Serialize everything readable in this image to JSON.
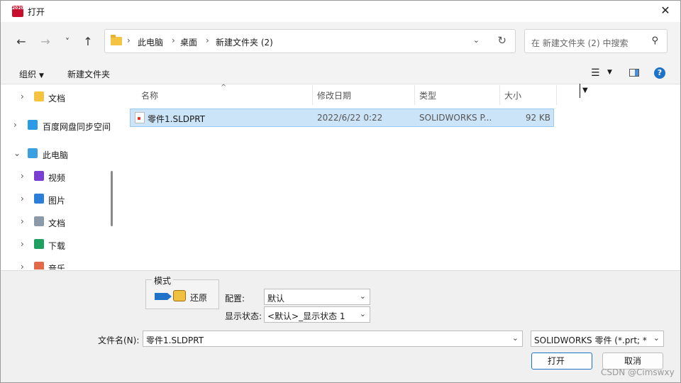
{
  "window": {
    "title": "打开",
    "app_icon_text": "2020"
  },
  "nav": {
    "back": "←",
    "forward": "→",
    "recent": "˅",
    "up": "↑"
  },
  "address": {
    "crumbs": [
      "此电脑",
      "桌面",
      "新建文件夹 (2)"
    ],
    "separator": "›"
  },
  "search": {
    "placeholder": "在 新建文件夹 (2) 中搜索"
  },
  "toolbar": {
    "organize": "组织",
    "new_folder": "新建文件夹"
  },
  "sidebar": {
    "items": [
      {
        "label": "文档",
        "icon": "document-icon",
        "color": "#f5c342",
        "indent": 1
      },
      {
        "label": "百度网盘同步空间",
        "icon": "baidu-netdisk-icon",
        "color": "#2b9be6",
        "indent": 0
      },
      {
        "label": "此电脑",
        "icon": "computer-icon",
        "color": "#3aa0e0",
        "indent": 0,
        "expanded": true
      },
      {
        "label": "视频",
        "icon": "video-icon",
        "color": "#7a3fd0",
        "indent": 1
      },
      {
        "label": "图片",
        "icon": "picture-icon",
        "color": "#2b7fd6",
        "indent": 1
      },
      {
        "label": "文档",
        "icon": "document-icon",
        "color": "#8a9aa8",
        "indent": 1
      },
      {
        "label": "下载",
        "icon": "download-icon",
        "color": "#20a060",
        "indent": 1
      },
      {
        "label": "音乐",
        "icon": "music-icon",
        "color": "#e06a4a",
        "indent": 1
      }
    ]
  },
  "columns": {
    "name": "名称",
    "date": "修改日期",
    "type": "类型",
    "size": "大小"
  },
  "files": [
    {
      "name": "零件1.SLDPRT",
      "date": "2022/6/22 0:22",
      "type": "SOLIDWORKS P...",
      "size": "92 KB"
    }
  ],
  "options": {
    "mode_legend": "模式",
    "mode_value": "还原",
    "config_label": "配置:",
    "config_value": "默认",
    "display_label": "显示状态:",
    "display_value": "<默认>_显示状态 1"
  },
  "footer": {
    "filename_label": "文件名(N):",
    "filename_value": "零件1.SLDPRT",
    "filter_value": "SOLIDWORKS 零件 (*.prt; *",
    "open_label": "打开",
    "cancel_label": "取消",
    "watermark": "CSDN @Cimswxy"
  }
}
